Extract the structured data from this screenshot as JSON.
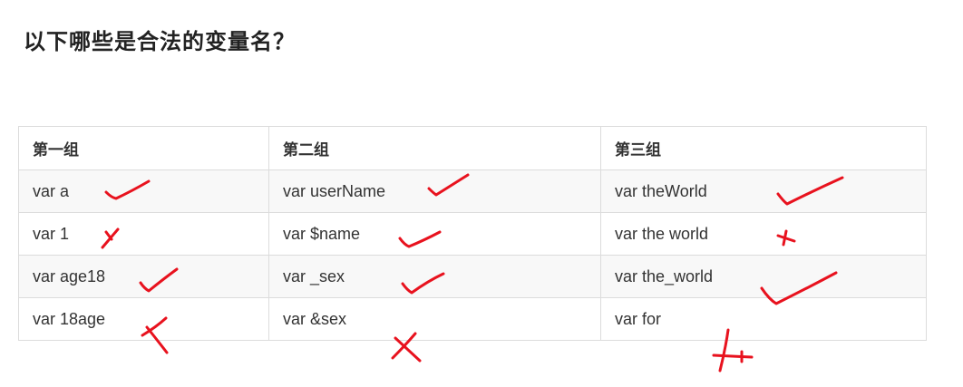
{
  "title": "以下哪些是合法的变量名？",
  "table": {
    "headers": [
      "第一组",
      "第二组",
      "第三组"
    ],
    "rows": [
      [
        "var a",
        "var userName",
        "var theWorld"
      ],
      [
        "var 1",
        "var $name",
        "var the world"
      ],
      [
        "var age18",
        "var _sex",
        "var the_world"
      ],
      [
        "var 18age",
        "var &sex",
        "var for"
      ]
    ]
  },
  "annotations": {
    "color": "#e8121e",
    "marks": [
      [
        "check",
        "check",
        "check"
      ],
      [
        "cross",
        "check",
        "cross"
      ],
      [
        "check",
        "check",
        "check"
      ],
      [
        "cross",
        "cross",
        "cross"
      ]
    ]
  }
}
